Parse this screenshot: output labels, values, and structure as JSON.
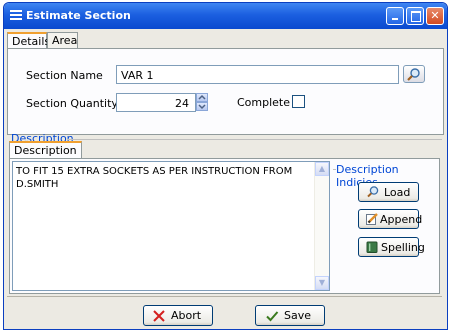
{
  "window": {
    "title": "Estimate Section"
  },
  "tabs": [
    "Details",
    "Area"
  ],
  "details": {
    "section_name_label": "Section Name",
    "section_name_value": "VAR 1",
    "section_quantity_label": "Section Quantity",
    "section_quantity_value": "24",
    "complete_label": "Complete",
    "complete_checked": false
  },
  "description": {
    "group_title": "Description",
    "tab_label": "Description",
    "text": "TO FIT 15 EXTRA SOCKETS AS PER INSTRUCTION FROM D.SMITH",
    "indicies_title": "Description Indicies",
    "buttons": {
      "load": "Load",
      "append": "Append",
      "spelling": "Spelling"
    }
  },
  "footer": {
    "abort": "Abort",
    "save": "Save"
  },
  "colors": {
    "titlebar": "#0a49cf",
    "group_title": "#0046d5",
    "tab_highlight": "#f0a030"
  }
}
